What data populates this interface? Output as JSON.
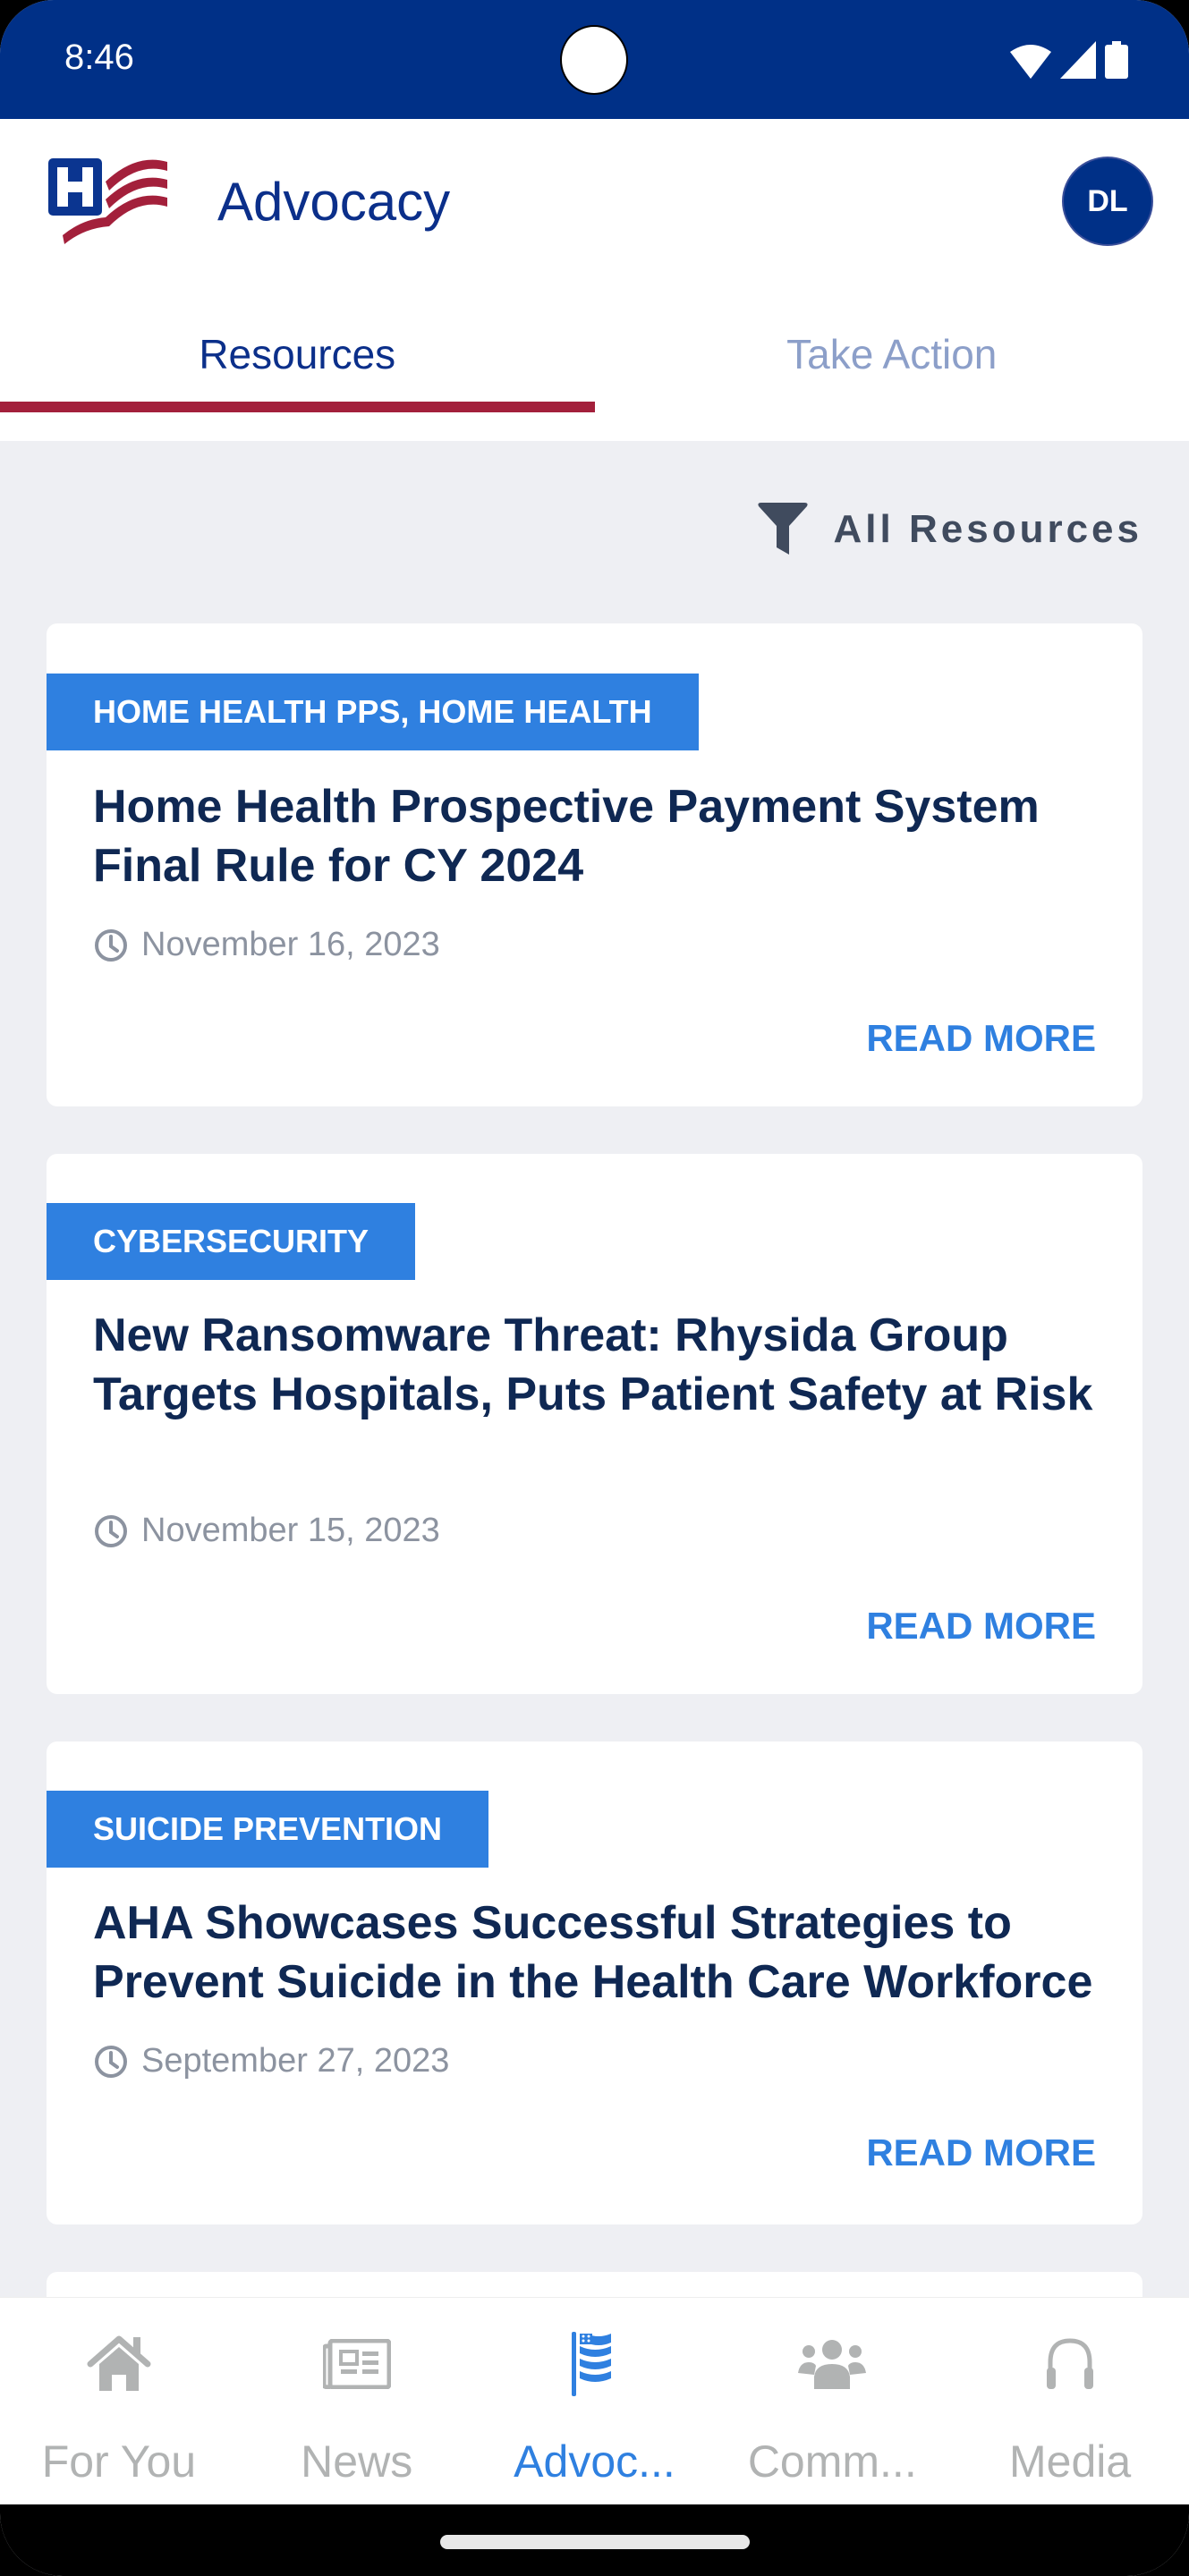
{
  "status_bar": {
    "time": "8:46",
    "icons": [
      "wifi-icon",
      "cellular-signal-icon",
      "battery-icon"
    ]
  },
  "header": {
    "title": "Advocacy",
    "logo": "aha-hospital-flag-logo",
    "avatar_initials": "DL"
  },
  "tabs": [
    {
      "label": "Resources",
      "active": true
    },
    {
      "label": "Take Action",
      "active": false
    }
  ],
  "filter": {
    "icon": "filter-icon",
    "label": "All Resources"
  },
  "articles": [
    {
      "tag": "HOME HEALTH PPS, HOME HEALTH",
      "title": "Home Health Prospective Payment System Final Rule for CY 2024",
      "date": "November 16, 2023",
      "action": "READ MORE"
    },
    {
      "tag": "CYBERSECURITY",
      "title": "New Ransomware Threat: Rhysida Group Targets Hospitals, Puts Patient Safety at Risk",
      "date": "November 15, 2023",
      "action": "READ MORE"
    },
    {
      "tag": "SUICIDE PREVENTION",
      "title": "AHA Showcases Successful Strategies to Prevent Suicide in the Health Care Workforce",
      "date": "September 27, 2023",
      "action": "READ MORE"
    }
  ],
  "bottom_nav": [
    {
      "label": "For You",
      "icon": "home-icon",
      "active": false
    },
    {
      "label": "News",
      "icon": "newspaper-icon",
      "active": false
    },
    {
      "label": "Advoc...",
      "icon": "flag-icon",
      "active": true
    },
    {
      "label": "Comm...",
      "icon": "users-icon",
      "active": false
    },
    {
      "label": "Media",
      "icon": "headphones-icon",
      "active": false
    }
  ],
  "colors": {
    "brand_navy": "#003087",
    "accent_red": "#a3203b",
    "accent_blue": "#2f80e0",
    "title_dark": "#0f2853",
    "inactive_gray": "#b1b3b3"
  }
}
